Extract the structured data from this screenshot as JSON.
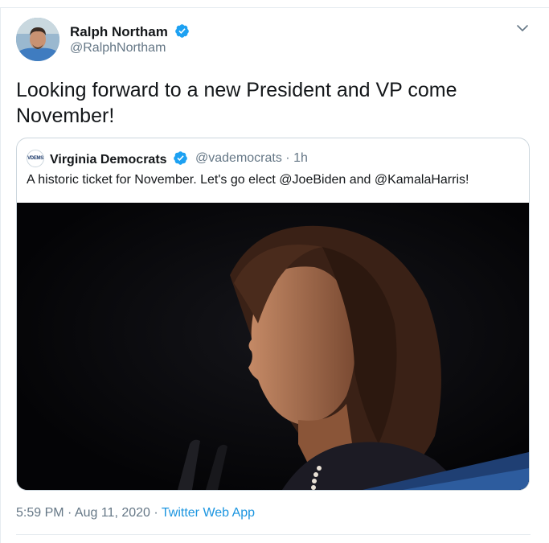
{
  "tweet": {
    "author_name": "Ralph Northam",
    "author_handle": "@RalphNortham",
    "text": "Looking forward to a new President and VP come November!",
    "timestamp": "5:59 PM · Aug 11, 2020",
    "separator": " · ",
    "source": "Twitter Web App",
    "verified": true,
    "menu_icon": "chevron-down-icon"
  },
  "quote": {
    "author_name": "Virginia Democrats",
    "author_handle": "@vademocrats",
    "time": "· 1h",
    "avatar_text": "VDEMS",
    "text": "A historic ticket for November. Let's go elect @JoeBiden and @KamalaHarris!",
    "verified": true
  },
  "colors": {
    "primary_text": "#14171a",
    "secondary_text": "#657786",
    "link": "#1b95e0",
    "verified_badge": "#1da1f2",
    "border": "#ccd6dd"
  }
}
